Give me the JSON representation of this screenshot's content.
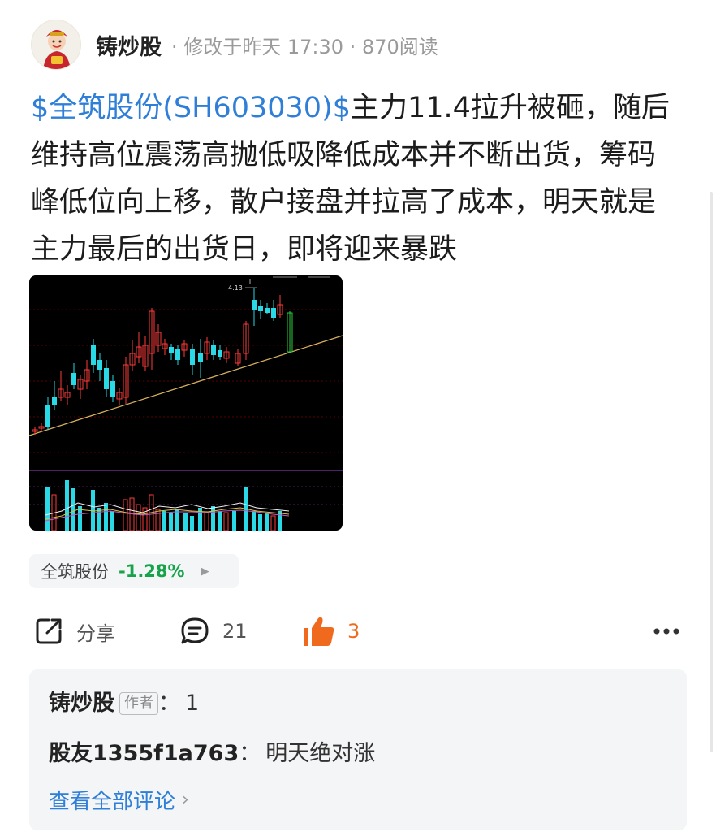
{
  "header": {
    "author": "铸炒股",
    "meta": "· 修改于昨天 17:30 · 870阅读"
  },
  "post": {
    "stock_link": "$全筑股份(SH603030)$",
    "body": "主力11.4拉升被砸，随后维持高位震荡高抛低吸降低成本并不断出货，筹码峰低位向上移，散户接盘并拉高了成本，明天就是主力最后的出货日，即将迎来暴跌"
  },
  "chart_image": {
    "price_label": "4.13"
  },
  "stock_chip": {
    "name": "全筑股份",
    "change": "-1.28%"
  },
  "actions": {
    "share_label": "分享",
    "comment_count": "21",
    "like_count": "3"
  },
  "comments": {
    "items": [
      {
        "user": "铸炒股",
        "tag": "作者",
        "sep": "：",
        "text": "1"
      },
      {
        "user": "股友1355f1a763",
        "sep": "：",
        "text": "明天绝对涨"
      }
    ],
    "view_all": "查看全部评论"
  },
  "colors": {
    "link": "#2f7fd8",
    "negative": "#16a34a",
    "like": "#f06a1e"
  }
}
